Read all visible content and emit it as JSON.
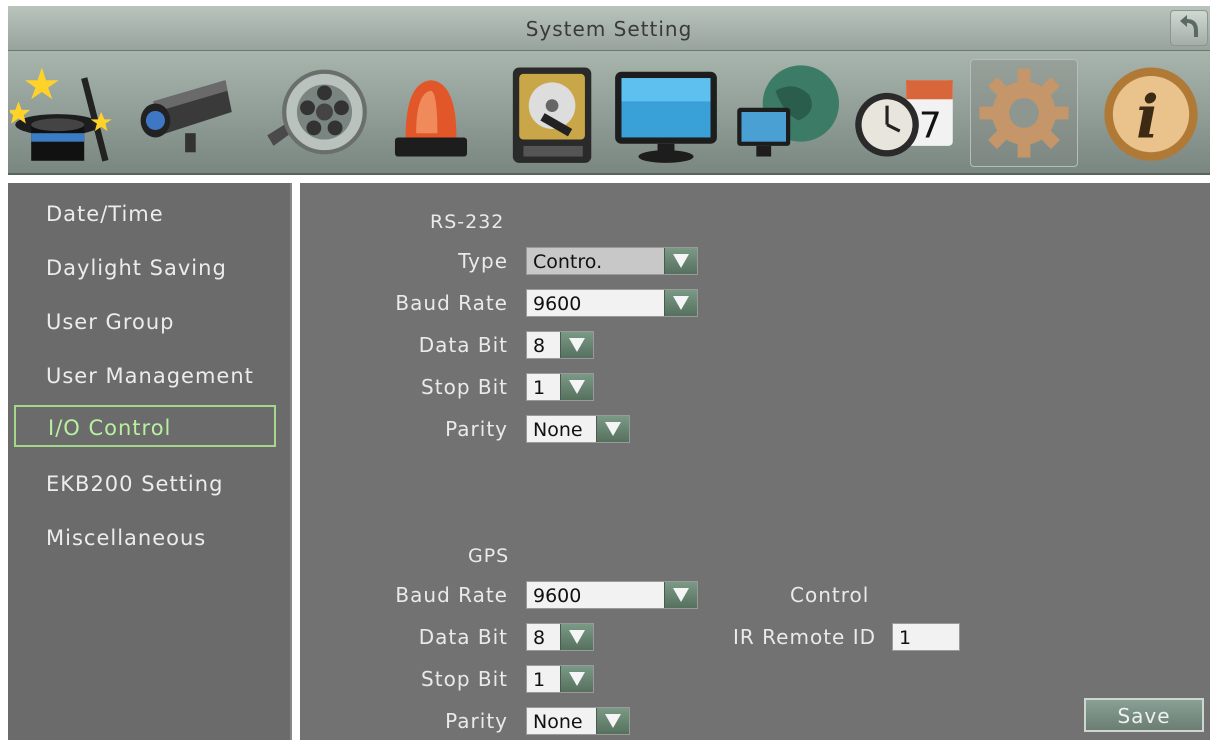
{
  "window": {
    "title": "System Setting"
  },
  "toolbar": {
    "icons": [
      "wizard-hat-icon",
      "camera-icon",
      "record-reel-icon",
      "alarm-light-icon",
      "hard-disk-icon",
      "monitor-icon",
      "network-globe-icon",
      "schedule-clock-calendar-icon",
      "gear-icon",
      "info-icon"
    ],
    "active": "gear-icon"
  },
  "sidebar": {
    "items": [
      {
        "label": "Date/Time"
      },
      {
        "label": "Daylight Saving"
      },
      {
        "label": "User Group"
      },
      {
        "label": "User Management"
      },
      {
        "label": "I/O Control"
      },
      {
        "label": "EKB200 Setting"
      },
      {
        "label": "Miscellaneous"
      }
    ],
    "selected": "I/O Control"
  },
  "rs232": {
    "title": "RS-232",
    "type_label": "Type",
    "type_value": "Contro.",
    "baud_label": "Baud Rate",
    "baud_value": "9600",
    "databit_label": "Data Bit",
    "databit_value": "8",
    "stopbit_label": "Stop Bit",
    "stopbit_value": "1",
    "parity_label": "Parity",
    "parity_value": "None"
  },
  "gps": {
    "title": "GPS",
    "baud_label": "Baud Rate",
    "baud_value": "9600",
    "databit_label": "Data Bit",
    "databit_value": "8",
    "stopbit_label": "Stop Bit",
    "stopbit_value": "1",
    "parity_label": "Parity",
    "parity_value": "None"
  },
  "control": {
    "title": "Control",
    "ir_label": "IR Remote ID",
    "ir_value": "1"
  },
  "actions": {
    "save": "Save"
  }
}
